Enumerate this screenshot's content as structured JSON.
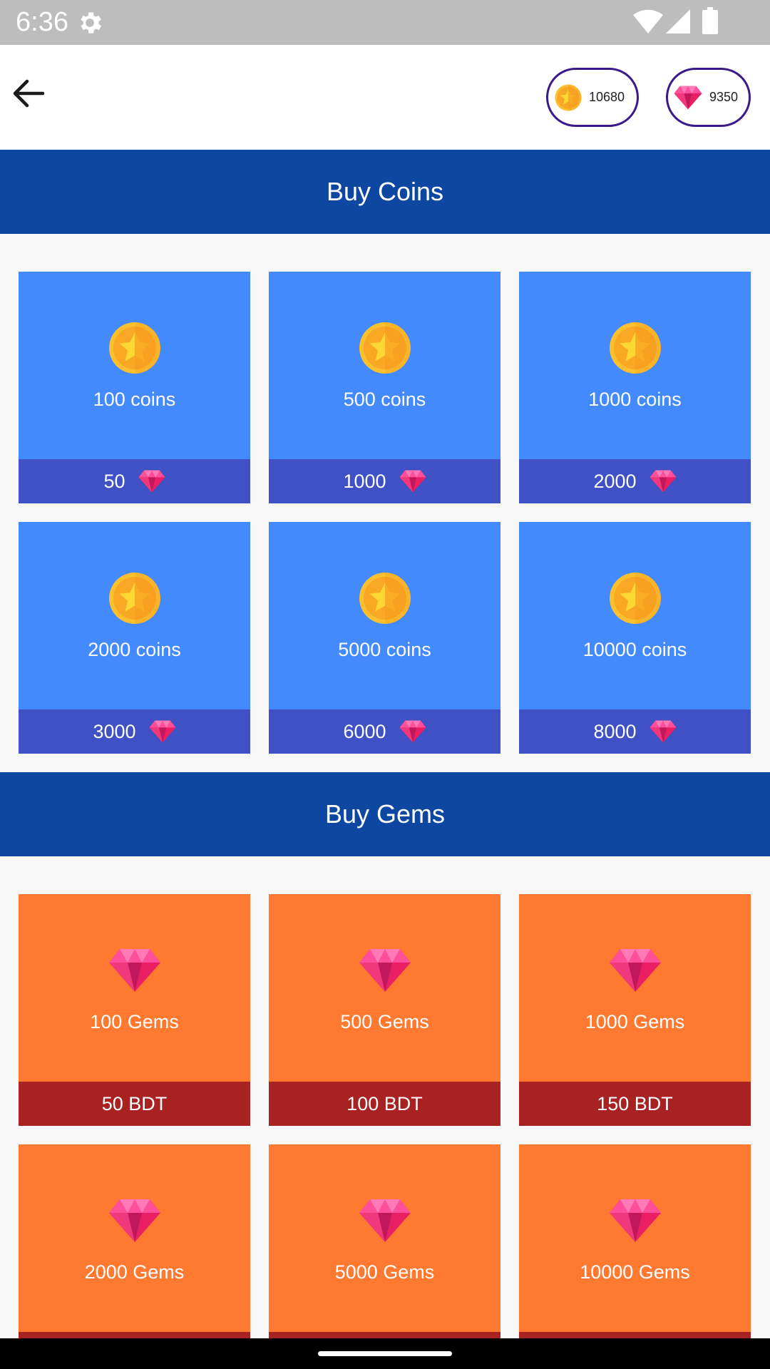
{
  "status_bar": {
    "time": "6:36"
  },
  "header": {
    "coin_balance": "10680",
    "gem_balance": "9350"
  },
  "coins_section": {
    "title": "Buy Coins",
    "items": [
      {
        "amount": "100 coins",
        "price": "50"
      },
      {
        "amount": "500 coins",
        "price": "1000"
      },
      {
        "amount": "1000 coins",
        "price": "2000"
      },
      {
        "amount": "2000 coins",
        "price": "3000"
      },
      {
        "amount": "5000 coins",
        "price": "6000"
      },
      {
        "amount": "10000 coins",
        "price": "8000"
      }
    ]
  },
  "gems_section": {
    "title": "Buy Gems",
    "items": [
      {
        "amount": "100 Gems",
        "price": "50 BDT"
      },
      {
        "amount": "500 Gems",
        "price": "100 BDT"
      },
      {
        "amount": "1000 Gems",
        "price": "150 BDT"
      },
      {
        "amount": "2000 Gems",
        "price": ""
      },
      {
        "amount": "5000 Gems",
        "price": ""
      },
      {
        "amount": "10000 Gems",
        "price": ""
      }
    ]
  },
  "colors": {
    "header_blue": "#0d47a1",
    "coin_card": "#448aff",
    "coin_card_footer": "#3f51c4",
    "gem_card": "#ff7a30",
    "gem_card_footer": "#a82222",
    "pill_border": "#3b1a8a"
  },
  "icons": {
    "back": "arrow-left-icon",
    "coin": "coin-star-icon",
    "gem": "pink-gem-icon",
    "settings": "gear-icon",
    "wifi": "wifi-icon",
    "signal": "signal-icon",
    "battery": "battery-icon"
  }
}
